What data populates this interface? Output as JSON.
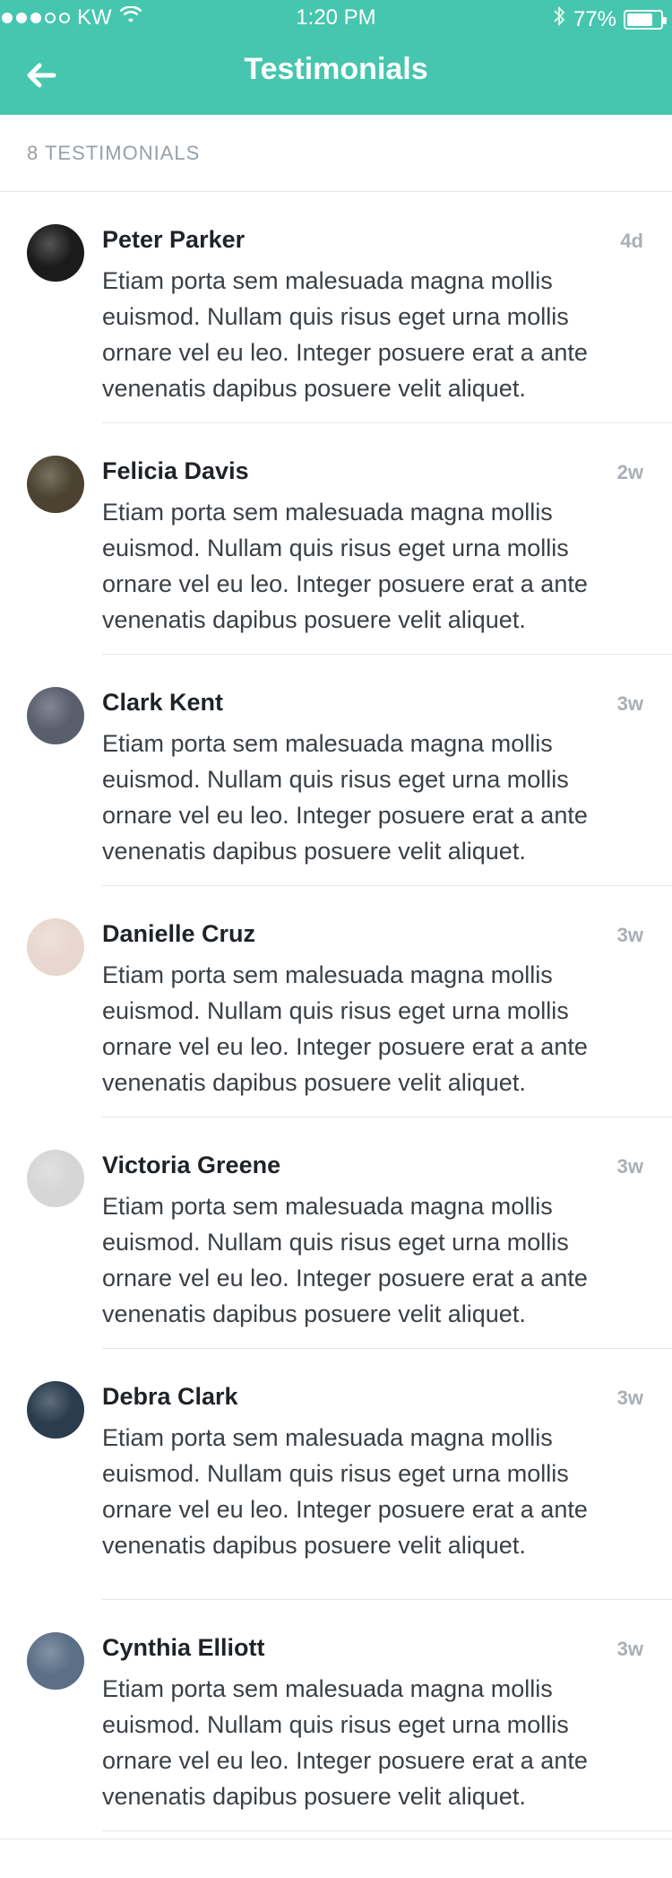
{
  "status": {
    "carrier": "KW",
    "time": "1:20 PM",
    "battery": "77%",
    "battery_level": 0.77,
    "signal_dots_filled": 3,
    "signal_dots_total": 5
  },
  "header": {
    "title": "Testimonials",
    "back_icon": "back-arrow-icon",
    "color": "#46c6ae"
  },
  "summary": {
    "count_label": "8 TESTIMONIALS"
  },
  "testimonials": [
    {
      "name": "Peter Parker",
      "time": "4d",
      "text": "Etiam porta sem malesuada magna mollis euismod. Nullam quis risus eget urna mollis ornare vel eu leo. Integer posuere erat a ante venenatis dapibus posuere velit aliquet.",
      "avatar_color": "#1b1b1b"
    },
    {
      "name": "Felicia Davis",
      "time": "2w",
      "text": "Etiam porta sem malesuada magna mollis euismod. Nullam quis risus eget urna mollis ornare vel eu leo. Integer posuere erat a ante venenatis dapibus posuere velit aliquet.",
      "avatar_color": "#4b4330"
    },
    {
      "name": "Clark Kent",
      "time": "3w",
      "text": "Etiam porta sem malesuada magna mollis euismod. Nullam quis risus eget urna mollis ornare vel eu leo. Integer posuere erat a ante venenatis dapibus posuere velit aliquet.",
      "avatar_color": "#5a5f6e"
    },
    {
      "name": "Danielle Cruz",
      "time": "3w",
      "text": "Etiam porta sem malesuada magna mollis euismod. Nullam quis risus eget urna mollis ornare vel eu leo. Integer posuere erat a ante venenatis dapibus posuere velit aliquet.",
      "avatar_color": "#e8d7cf"
    },
    {
      "name": "Victoria Greene",
      "time": "3w",
      "text": "Etiam porta sem malesuada magna mollis euismod. Nullam quis risus eget urna mollis ornare vel eu leo. Integer posuere erat a ante venenatis dapibus posuere velit aliquet.",
      "avatar_color": "#d6d6d6"
    },
    {
      "name": "Debra Clark",
      "time": "3w",
      "text": "Etiam porta sem malesuada magna mollis euismod. Nullam quis risus eget urna mollis ornare vel eu leo. Integer posuere erat a ante venenatis dapibus posuere velit aliquet.",
      "avatar_color": "#2a3c4d"
    },
    {
      "name": "Cynthia Elliott",
      "time": "3w",
      "text": "Etiam porta sem malesuada magna mollis euismod. Nullam quis risus eget urna mollis ornare vel eu leo. Integer posuere erat a ante venenatis dapibus posuere velit aliquet.",
      "avatar_color": "#5b6f86"
    }
  ]
}
